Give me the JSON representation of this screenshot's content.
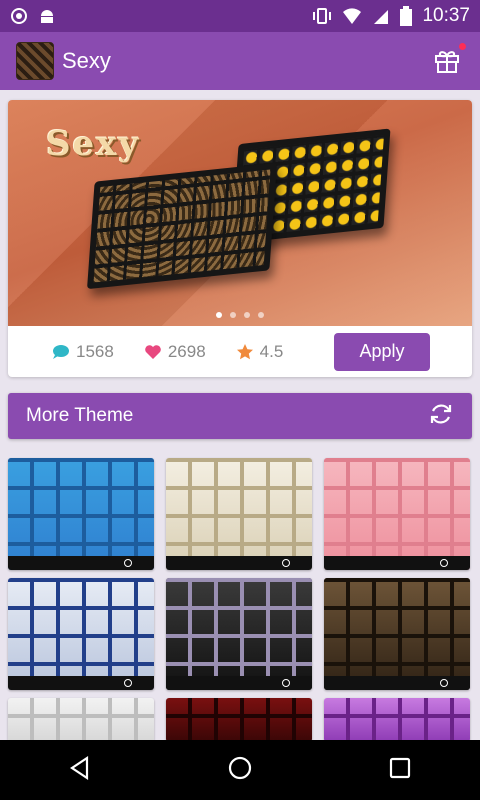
{
  "status_bar": {
    "time": "10:37"
  },
  "app_bar": {
    "title": "Sexy"
  },
  "hero": {
    "banner_title": "Sexy",
    "comments": "1568",
    "likes": "2698",
    "rating": "4.5",
    "apply_label": "Apply",
    "slide_count": 4,
    "active_slide": 1
  },
  "more_theme": {
    "title": "More Theme"
  },
  "colors": {
    "primary": "#8a4bb0",
    "status_bar": "#6b2f8f",
    "comment_icon": "#2fb7c7",
    "heart_icon": "#e8487f",
    "star_icon": "#f08a3c"
  },
  "icons": {
    "gift": "gift-icon",
    "refresh": "refresh-icon",
    "comment": "comment-icon",
    "heart": "heart-icon",
    "star": "star-icon"
  }
}
